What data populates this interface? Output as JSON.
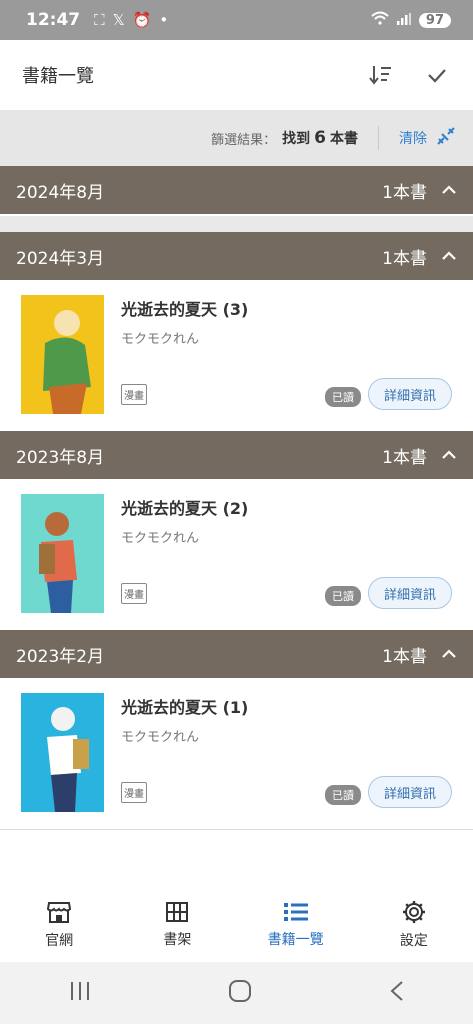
{
  "status": {
    "time": "12:47",
    "battery": "97"
  },
  "header": {
    "title": "書籍一覽"
  },
  "filter": {
    "label": "篩選結果：",
    "found_prefix": "找到",
    "found_count": "6",
    "found_suffix": "本書",
    "clear": "清除"
  },
  "groups": [
    {
      "date": "2024年8月",
      "count": "1本書"
    },
    {
      "date": "2024年3月",
      "count": "1本書"
    },
    {
      "date": "2023年8月",
      "count": "1本書"
    },
    {
      "date": "2023年2月",
      "count": "1本書"
    }
  ],
  "books": [
    {
      "title": "光逝去的夏天 (3)",
      "author": "モクモクれん",
      "tag": "漫畫",
      "status": "已讀",
      "action": "詳細資訊",
      "cover_color": "#f2c31a"
    },
    {
      "title": "光逝去的夏天 (2)",
      "author": "モクモクれん",
      "tag": "漫畫",
      "status": "已讀",
      "action": "詳細資訊",
      "cover_color": "#6fd9d0"
    },
    {
      "title": "光逝去的夏天 (1)",
      "author": "モクモクれん",
      "tag": "漫畫",
      "status": "已讀",
      "action": "詳細資訊",
      "cover_color": "#2bb3e0"
    }
  ],
  "nav": {
    "items": [
      "官網",
      "書架",
      "書籍一覽",
      "設定"
    ],
    "active": "書籍一覽"
  }
}
